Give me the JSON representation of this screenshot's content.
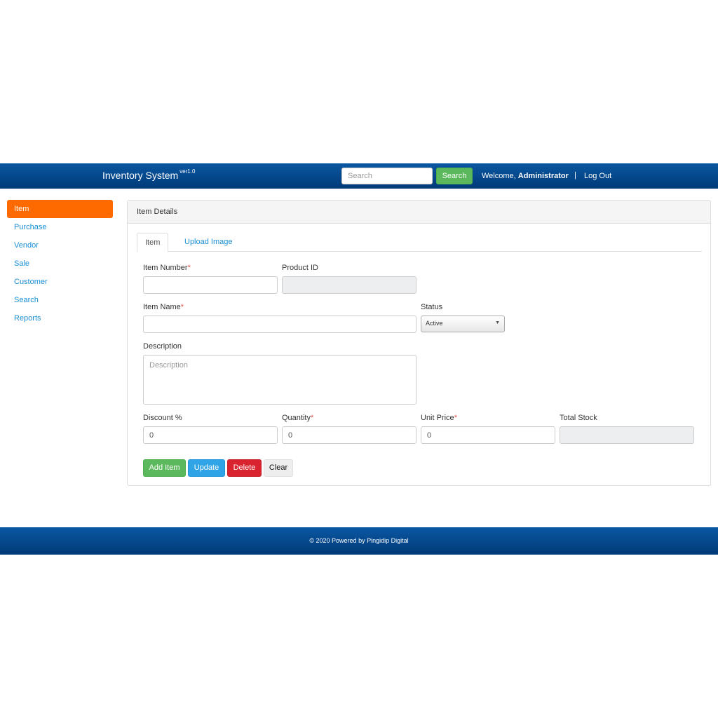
{
  "header": {
    "brand": "Inventory System",
    "version": "ver1.0",
    "search_placeholder": "Search",
    "search_button": "Search",
    "welcome_prefix": "Welcome,",
    "username": "Administrator",
    "separator": "|",
    "logout": "Log Out"
  },
  "sidebar": {
    "items": [
      {
        "label": "Item",
        "active": true
      },
      {
        "label": "Purchase"
      },
      {
        "label": "Vendor"
      },
      {
        "label": "Sale"
      },
      {
        "label": "Customer"
      },
      {
        "label": "Search"
      },
      {
        "label": "Reports"
      }
    ]
  },
  "panel": {
    "title": "Item Details",
    "tabs": [
      {
        "label": "Item",
        "active": true
      },
      {
        "label": "Upload Image"
      }
    ]
  },
  "form": {
    "item_number": {
      "label": "Item Number",
      "required_mark": "*",
      "value": ""
    },
    "product_id": {
      "label": "Product ID",
      "value": ""
    },
    "item_name": {
      "label": "Item Name",
      "required_mark": "*",
      "value": ""
    },
    "status": {
      "label": "Status",
      "value": "Active"
    },
    "description": {
      "label": "Description",
      "placeholder": "Description"
    },
    "discount": {
      "label": "Discount %",
      "value": "0"
    },
    "quantity": {
      "label": "Quantity",
      "required_mark": "*",
      "value": "0"
    },
    "unit_price": {
      "label": "Unit Price",
      "required_mark": "*",
      "value": "0"
    },
    "total_stock": {
      "label": "Total Stock",
      "value": ""
    }
  },
  "buttons": {
    "add": "Add Item",
    "update": "Update",
    "delete": "Delete",
    "clear": "Clear"
  },
  "footer": {
    "text": "© 2020 Powered by Pingidip Digital"
  },
  "colors": {
    "header": "#0a57a2",
    "active_nav": "#ff6a00",
    "link": "#1a8fd6",
    "success": "#5cb85c",
    "info": "#2fa4e7",
    "danger": "#d9232e"
  }
}
